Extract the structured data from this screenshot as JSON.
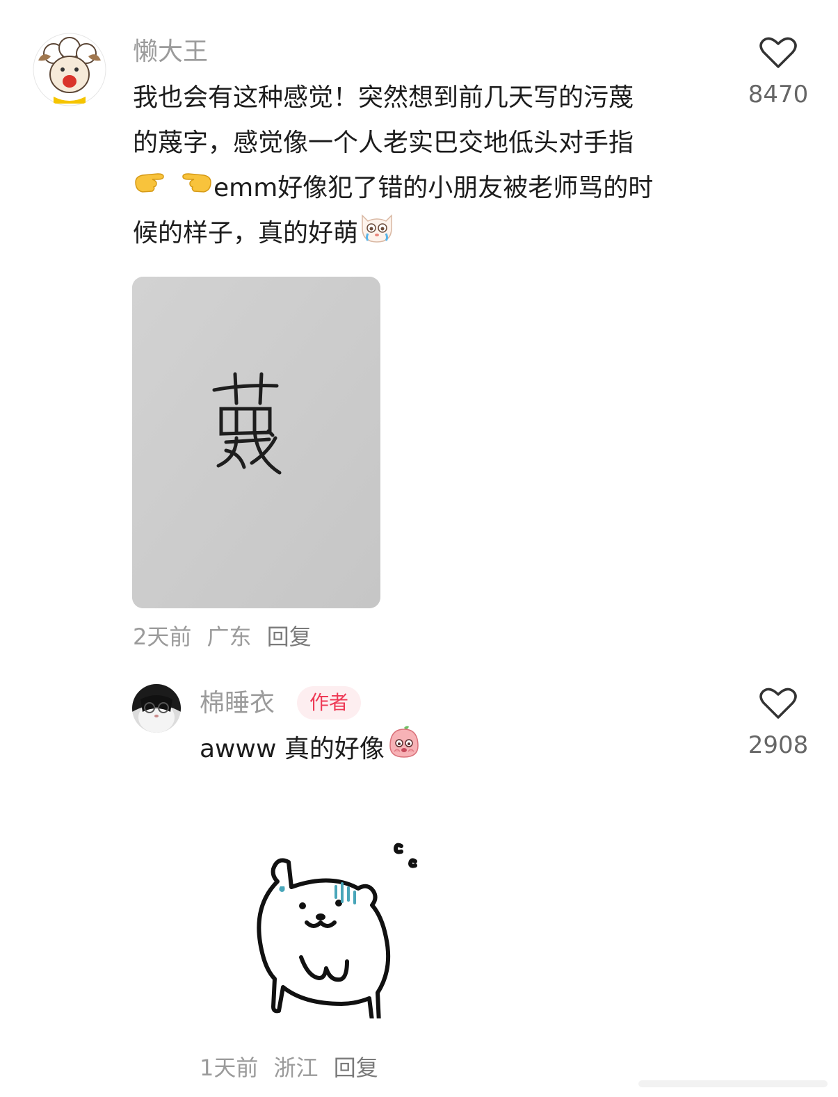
{
  "comments": [
    {
      "username": "懒大王",
      "text_lines": [
        [
          "我也会有这种感觉！突然想到前几天写的污蔑"
        ],
        [
          "的蔑字，感觉像一个人老实巴交地低头对手指"
        ],
        [
          "emm好像犯了错的小朋友被老师骂的时"
        ],
        [
          "候的样子，真的好萌"
        ]
      ],
      "emoji_icons": [
        "pointing-right-hand-icon",
        "pointing-left-hand-icon",
        "crying-cat-emoji-icon"
      ],
      "image": {
        "handwritten_text": "蔑"
      },
      "time": "2天前",
      "location": "广东",
      "reply_label": "回复",
      "like_count": "8470"
    },
    {
      "username": "棉睡衣",
      "badge": "作者",
      "text": "awww 真的好像",
      "emoji_icons": [
        "blushing-pink-emoji-icon"
      ],
      "sticker": "sweating-bear-sticker",
      "time": "1天前",
      "location": "浙江",
      "reply_label": "回复",
      "like_count": "2908"
    }
  ],
  "colors": {
    "username": "#9b9b9b",
    "text": "#1c1c1c",
    "badge_text": "#ee3a56",
    "badge_bg": "#fdeef0",
    "meta": "#9b9b9b"
  }
}
